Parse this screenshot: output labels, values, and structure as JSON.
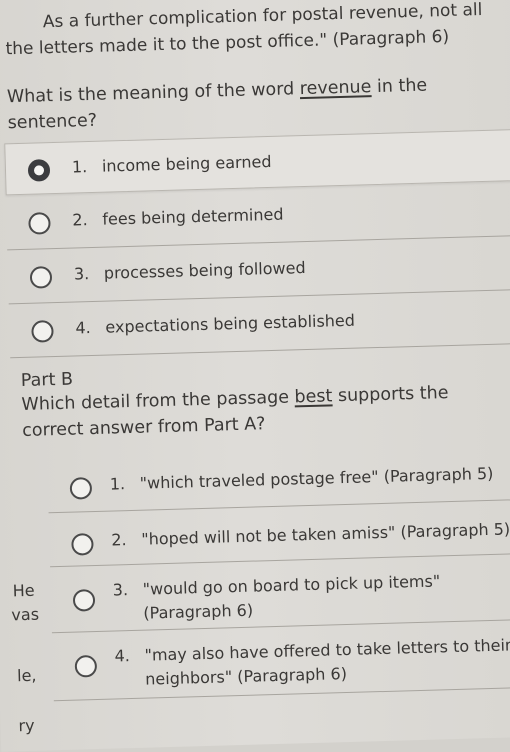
{
  "intro": {
    "line1": "As a further complication for postal revenue, not all",
    "line2": "the letters made it to the post office.\" (Paragraph 6)"
  },
  "partA": {
    "question_line1_pre": "What is the meaning of the word ",
    "question_word": "revenue",
    "question_line1_post": " in the",
    "question_line2": "sentence?",
    "options": [
      {
        "num": "1.",
        "text": "income being earned",
        "selected": true
      },
      {
        "num": "2.",
        "text": "fees being determined",
        "selected": false
      },
      {
        "num": "3.",
        "text": "processes being followed",
        "selected": false
      },
      {
        "num": "4.",
        "text": "expectations being established",
        "selected": false
      }
    ]
  },
  "partB": {
    "title": "Part B",
    "question_line1_pre": "Which detail from the passage ",
    "question_word": "best",
    "question_line1_post": " supports the",
    "question_line2": "correct answer from Part A?",
    "options": [
      {
        "num": "1.",
        "line1": "\"which traveled postage free\" (Paragraph 5)",
        "line2": ""
      },
      {
        "num": "2.",
        "line1": "\"hoped will not be taken amiss\" (Paragraph 5)",
        "line2": ""
      },
      {
        "num": "3.",
        "line1": "\"would go on board to pick up items\"",
        "line2": "(Paragraph 6)"
      },
      {
        "num": "4.",
        "line1": "\"may also have offered to take letters to their",
        "line2": "neighbors\" (Paragraph 6)"
      }
    ]
  },
  "margin": {
    "t1": "He",
    "t2": "vas",
    "t3": "le,",
    "t4": "ry"
  }
}
